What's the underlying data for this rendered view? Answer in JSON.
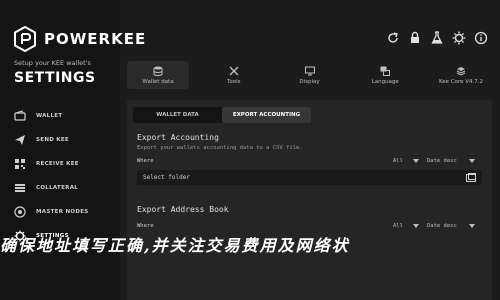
{
  "brand": {
    "name": "POWERKEE"
  },
  "sidebar": {
    "setup_text": "Setup your KEE wallet's",
    "title": "SETTINGS",
    "items": [
      {
        "label": "WALLET",
        "icon": "wallet-icon"
      },
      {
        "label": "SEND KEE",
        "icon": "send-icon"
      },
      {
        "label": "RECEIVE KEE",
        "icon": "receive-icon"
      },
      {
        "label": "COLLATERAL",
        "icon": "collateral-icon"
      },
      {
        "label": "MASTER NODES",
        "icon": "master-nodes-icon"
      },
      {
        "label": "SETTINGS",
        "icon": "settings-icon"
      }
    ]
  },
  "topbar": {
    "icons": [
      "refresh-icon",
      "lock-icon",
      "flask-icon",
      "gear-icon",
      "info-icon"
    ]
  },
  "tabs": [
    {
      "label": "Wallet data",
      "icon": "database-icon",
      "active": true
    },
    {
      "label": "Tools",
      "icon": "tools-icon",
      "active": false
    },
    {
      "label": "Display",
      "icon": "display-icon",
      "active": false
    },
    {
      "label": "Language",
      "icon": "language-icon",
      "active": false
    },
    {
      "label": "Kee Core V4.7.2",
      "icon": "kee-core-icon",
      "active": false
    }
  ],
  "subtabs": [
    {
      "label": "WALLET DATA",
      "active": false
    },
    {
      "label": "EXPORT ACCOUNTING",
      "active": true
    }
  ],
  "export_accounting": {
    "title": "Export Accounting",
    "description": "Export your wallets accounting data to a CSV file.",
    "where_label": "Where",
    "filter_value": "All",
    "sort_value": "Date desc",
    "folder_placeholder": "Select folder"
  },
  "export_address_book": {
    "title": "Export Address Book",
    "where_label": "Where",
    "filter_value": "All",
    "sort_value": "Date desc"
  },
  "overlay_caption": "确保地址填写正确,并关注交易费用及网络状",
  "colors": {
    "background": "#1c1c1c",
    "sidebar": "#141414",
    "panel": "#252525",
    "text": "#ffffff"
  }
}
